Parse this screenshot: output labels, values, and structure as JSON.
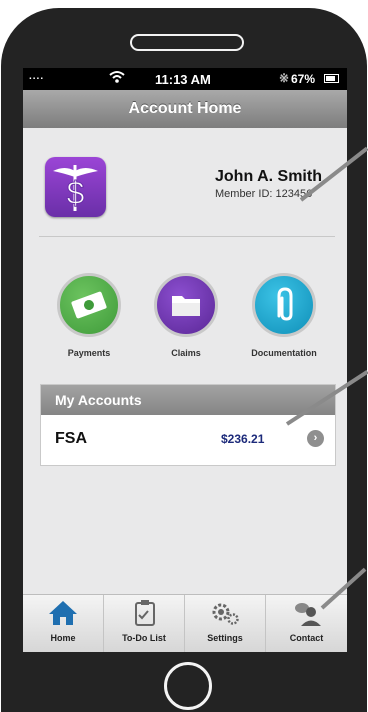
{
  "status_bar": {
    "signal": "....",
    "time": "11:13 AM",
    "battery": "67%"
  },
  "header": {
    "title": "Account Home"
  },
  "profile": {
    "name": "John A. Smith",
    "member_id": "Member ID: 123456"
  },
  "actions": [
    {
      "label": "Payments",
      "icon": "money-icon",
      "color": "#3f9b3a"
    },
    {
      "label": "Claims",
      "icon": "folder-icon",
      "color": "#6a2fa8"
    },
    {
      "label": "Documentation",
      "icon": "paperclip-icon",
      "color": "#129fc8"
    }
  ],
  "accounts": {
    "title": "My Accounts",
    "items": [
      {
        "name": "FSA",
        "balance": "$236.21"
      }
    ]
  },
  "tabs": [
    {
      "label": "Home",
      "icon": "home-icon"
    },
    {
      "label": "To-Do List",
      "icon": "clipboard-icon"
    },
    {
      "label": "Settings",
      "icon": "gears-icon"
    },
    {
      "label": "Contact",
      "icon": "contact-icon"
    }
  ],
  "colors": {
    "accent_blue": "#1f6fb0",
    "balance": "#1c2a7a"
  }
}
